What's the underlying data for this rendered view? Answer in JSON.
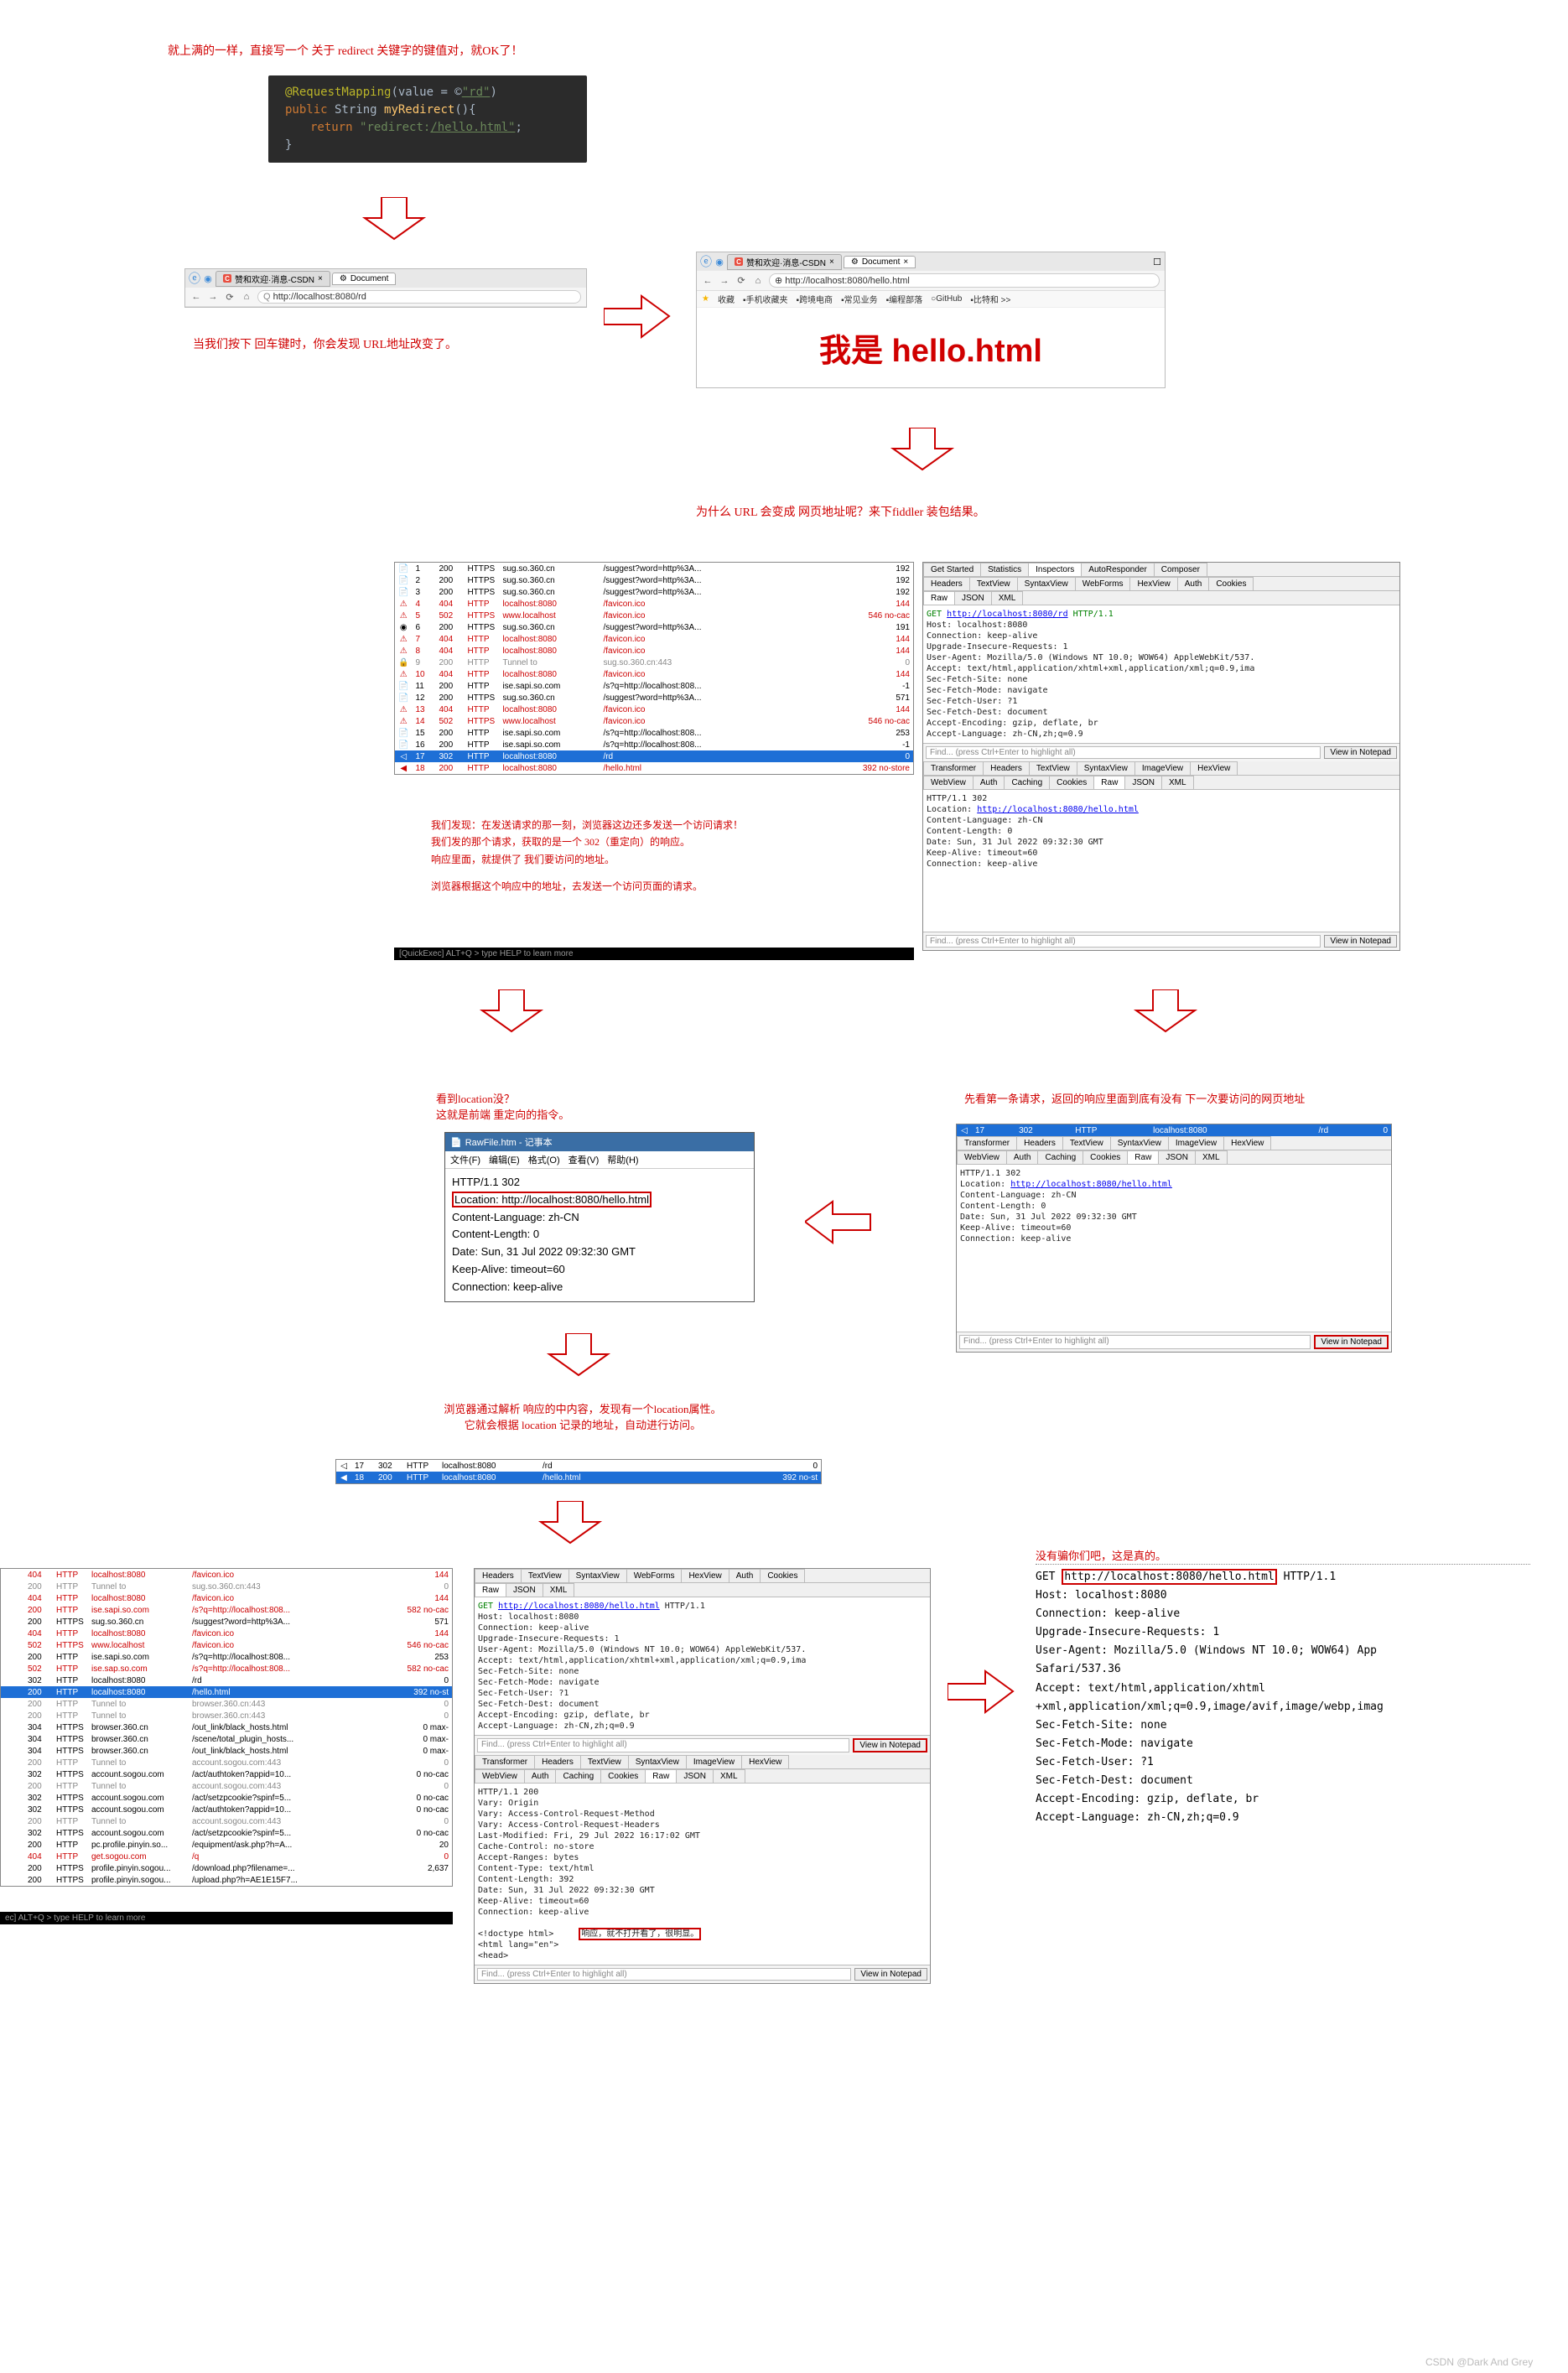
{
  "top_note": "就上满的一样，直接写一个 关于 redirect 关键字的键值对，就OK了！",
  "code": {
    "l1a": "@RequestMapping",
    "l1b": "(value = ",
    "l1c": "©",
    "l1d": "\"rd\"",
    "l1e": ")",
    "l2a": "public",
    "l2b": " String ",
    "l2c": "myRedirect",
    "l2d": "(){",
    "l3a": "return ",
    "l3b": "\"redirect:",
    "l3c": "/hello.html\"",
    "l3d": ";",
    "l4": "}"
  },
  "browser1": {
    "tab1": "赞和欢迎·消息-CSDN",
    "tab2": "Document",
    "url": "http://localhost:8080/rd",
    "url_prefix": "Q"
  },
  "note_below_browser1": "当我们按下 回车键时，你会发现 URL地址改变了。",
  "browser2": {
    "tab1": "赞和欢迎·消息-CSDN",
    "tab2": "Document",
    "url": "http://localhost:8080/hello.html",
    "bookmarks": [
      "收藏",
      "手机收藏夹",
      "跨境电商",
      "常见业务",
      "编程部落",
      "GitHub",
      "比特和 >>"
    ]
  },
  "huge": "我是 hello.html",
  "note_mid": "为什么 URL 会变成 网页地址呢？来下fiddler 装包结果。",
  "fiddler_main_rows": [
    {
      "ic": "📄",
      "n": "1",
      "st": "200",
      "pr": "HTTPS",
      "host": "sug.so.360.cn",
      "path": "/suggest?word=http%3A...",
      "bl": "192",
      "cls": ""
    },
    {
      "ic": "📄",
      "n": "2",
      "st": "200",
      "pr": "HTTPS",
      "host": "sug.so.360.cn",
      "path": "/suggest?word=http%3A...",
      "bl": "192",
      "cls": ""
    },
    {
      "ic": "📄",
      "n": "3",
      "st": "200",
      "pr": "HTTPS",
      "host": "sug.so.360.cn",
      "path": "/suggest?word=http%3A...",
      "bl": "192",
      "cls": ""
    },
    {
      "ic": "⚠",
      "n": "4",
      "st": "404",
      "pr": "HTTP",
      "host": "localhost:8080",
      "path": "/favicon.ico",
      "bl": "144",
      "cls": "red"
    },
    {
      "ic": "⚠",
      "n": "5",
      "st": "502",
      "pr": "HTTPS",
      "host": "www.localhost",
      "path": "/favicon.ico",
      "bl": "546  no-cac",
      "cls": "red"
    },
    {
      "ic": "◉",
      "n": "6",
      "st": "200",
      "pr": "HTTPS",
      "host": "sug.so.360.cn",
      "path": "/suggest?word=http%3A...",
      "bl": "191",
      "cls": ""
    },
    {
      "ic": "⚠",
      "n": "7",
      "st": "404",
      "pr": "HTTP",
      "host": "localhost:8080",
      "path": "/favicon.ico",
      "bl": "144",
      "cls": "red"
    },
    {
      "ic": "⚠",
      "n": "8",
      "st": "404",
      "pr": "HTTP",
      "host": "localhost:8080",
      "path": "/favicon.ico",
      "bl": "144",
      "cls": "red"
    },
    {
      "ic": "🔒",
      "n": "9",
      "st": "200",
      "pr": "HTTP",
      "host": "Tunnel to",
      "path": "sug.so.360.cn:443",
      "bl": "0",
      "cls": "gray"
    },
    {
      "ic": "⚠",
      "n": "10",
      "st": "404",
      "pr": "HTTP",
      "host": "localhost:8080",
      "path": "/favicon.ico",
      "bl": "144",
      "cls": "red"
    },
    {
      "ic": "📄",
      "n": "11",
      "st": "200",
      "pr": "HTTP",
      "host": "ise.sapi.so.com",
      "path": "/s?q=http://localhost:808...",
      "bl": "-1",
      "cls": ""
    },
    {
      "ic": "📄",
      "n": "12",
      "st": "200",
      "pr": "HTTPS",
      "host": "sug.so.360.cn",
      "path": "/suggest?word=http%3A...",
      "bl": "571",
      "cls": ""
    },
    {
      "ic": "⚠",
      "n": "13",
      "st": "404",
      "pr": "HTTP",
      "host": "localhost:8080",
      "path": "/favicon.ico",
      "bl": "144",
      "cls": "red"
    },
    {
      "ic": "⚠",
      "n": "14",
      "st": "502",
      "pr": "HTTPS",
      "host": "www.localhost",
      "path": "/favicon.ico",
      "bl": "546  no-cac",
      "cls": "red"
    },
    {
      "ic": "📄",
      "n": "15",
      "st": "200",
      "pr": "HTTP",
      "host": "ise.sapi.so.com",
      "path": "/s?q=http://localhost:808...",
      "bl": "253",
      "cls": ""
    },
    {
      "ic": "📄",
      "n": "16",
      "st": "200",
      "pr": "HTTP",
      "host": "ise.sapi.so.com",
      "path": "/s?q=http://localhost:808...",
      "bl": "-1",
      "cls": ""
    },
    {
      "ic": "◁",
      "n": "17",
      "st": "302",
      "pr": "HTTP",
      "host": "localhost:8080",
      "path": "/rd",
      "bl": "0",
      "cls": "sel"
    },
    {
      "ic": "◀",
      "n": "18",
      "st": "200",
      "pr": "HTTP",
      "host": "localhost:8080",
      "path": "/hello.html",
      "bl": "392  no-store",
      "cls": "red"
    }
  ],
  "fiddler_analysis_note": {
    "l1": "我们发现：在发送请求的那一刻，浏览器这边还多发送一个访问请求！",
    "l2": "我们发的那个请求，获取的是一个 302（重定向）的响应。",
    "l3": "响应里面，就提供了 我们要访问的地址。",
    "l4": "浏览器根据这个响应中的地址，去发送一个访问页面的请求。"
  },
  "quickexec": "[QuickExec] ALT+Q > type HELP to learn more",
  "inspector_tabs_top": [
    "Get Started",
    "Statistics",
    "Inspectors",
    "AutoResponder",
    "Composer"
  ],
  "inspector_tabs_req": [
    "Headers",
    "TextView",
    "SyntaxView",
    "WebForms",
    "HexView",
    "Auth",
    "Cookies"
  ],
  "inspector_tabs_raw": [
    "Raw",
    "JSON",
    "XML"
  ],
  "req_raw": "GET http://localhost:8080/rd HTTP/1.1\nHost: localhost:8080\nConnection: keep-alive\nUpgrade-Insecure-Requests: 1\nUser-Agent: Mozilla/5.0 (Windows NT 10.0; WOW64) AppleWebKit/537.\nAccept: text/html,application/xhtml+xml,application/xml;q=0.9,ima\nSec-Fetch-Site: none\nSec-Fetch-Mode: navigate\nSec-Fetch-User: ?1\nSec-Fetch-Dest: document\nAccept-Encoding: gzip, deflate, br\nAccept-Language: zh-CN,zh;q=0.9",
  "find_placeholder": "Find... (press Ctrl+Enter to highlight all)",
  "notepad_btn": "View in Notepad",
  "inspector_tabs_res": [
    "Transformer",
    "Headers",
    "TextView",
    "SyntaxView",
    "ImageView",
    "HexView"
  ],
  "inspector_tabs_res2": [
    "WebView",
    "Auth",
    "Caching",
    "Cookies",
    "Raw",
    "JSON",
    "XML"
  ],
  "res_raw": "HTTP/1.1 302\nLocation: http://localhost:8080/hello.html\nContent-Language: zh-CN\nContent-Length: 0\nDate: Sun, 31 Jul 2022 09:32:30 GMT\nKeep-Alive: timeout=60\nConnection: keep-alive",
  "note_loc1": "看到location没？",
  "note_loc2": "这就是前端 重定向的指令。",
  "note_first_req": "先看第一条请求，返回的响应里面到底有没有 下一次要访问的网页地址",
  "notepad": {
    "title": "RawFile.htm - 记事本",
    "menu": [
      "文件(F)",
      "编辑(E)",
      "格式(O)",
      "查看(V)",
      "帮助(H)"
    ],
    "lines": [
      "HTTP/1.1 302",
      "Location: http://localhost:8080/hello.html",
      "Content-Language: zh-CN",
      "Content-Length: 0",
      "Date: Sun, 31 Jul 2022 09:32:30 GMT",
      "Keep-Alive: timeout=60",
      "Connection: keep-alive"
    ]
  },
  "note_parse1": "浏览器通过解析 响应的中内容，发现有一个location属性。",
  "note_parse2": "它就会根据 location 记录的地址，自动进行访问。",
  "fiddler_mini_rows": [
    {
      "ic": "◁",
      "n": "17",
      "st": "302",
      "pr": "HTTP",
      "host": "localhost:8080",
      "path": "/rd",
      "bl": "0",
      "cls": ""
    },
    {
      "ic": "◀",
      "n": "18",
      "st": "200",
      "pr": "HTTP",
      "host": "localhost:8080",
      "path": "/hello.html",
      "bl": "392  no-st",
      "cls": "sel"
    }
  ],
  "fiddler_bottom_rows": [
    {
      "n": "",
      "st": "404",
      "pr": "HTTP",
      "host": "localhost:8080",
      "path": "/favicon.ico",
      "bl": "144",
      "cls": "red"
    },
    {
      "n": "",
      "st": "200",
      "pr": "HTTP",
      "host": "Tunnel to",
      "path": "sug.so.360.cn:443",
      "bl": "0",
      "cls": "gray"
    },
    {
      "n": "",
      "st": "404",
      "pr": "HTTP",
      "host": "localhost:8080",
      "path": "/favicon.ico",
      "bl": "144",
      "cls": "red"
    },
    {
      "n": "",
      "st": "200",
      "pr": "HTTP",
      "host": "ise.sapi.so.com",
      "path": "/s?q=http://localhost:808...",
      "bl": "582  no-cac",
      "cls": "red"
    },
    {
      "n": "",
      "st": "200",
      "pr": "HTTPS",
      "host": "sug.so.360.cn",
      "path": "/suggest?word=http%3A...",
      "bl": "571",
      "cls": ""
    },
    {
      "n": "",
      "st": "404",
      "pr": "HTTP",
      "host": "localhost:8080",
      "path": "/favicon.ico",
      "bl": "144",
      "cls": "red"
    },
    {
      "n": "",
      "st": "502",
      "pr": "HTTPS",
      "host": "www.localhost",
      "path": "/favicon.ico",
      "bl": "546  no-cac",
      "cls": "red"
    },
    {
      "n": "",
      "st": "200",
      "pr": "HTTP",
      "host": "ise.sapi.so.com",
      "path": "/s?q=http://localhost:808...",
      "bl": "253",
      "cls": ""
    },
    {
      "n": "",
      "st": "502",
      "pr": "HTTP",
      "host": "ise.sap.so.com",
      "path": "/s?q=http://localhost:808...",
      "bl": "582  no-cac",
      "cls": "red"
    },
    {
      "n": "",
      "st": "302",
      "pr": "HTTP",
      "host": "localhost:8080",
      "path": "/rd",
      "bl": "0",
      "cls": ""
    },
    {
      "n": "",
      "st": "200",
      "pr": "HTTP",
      "host": "localhost:8080",
      "path": "/hello.html",
      "bl": "392  no-st",
      "cls": "sel"
    },
    {
      "n": "",
      "st": "200",
      "pr": "HTTP",
      "host": "Tunnel to",
      "path": "browser.360.cn:443",
      "bl": "0",
      "cls": "gray"
    },
    {
      "n": "",
      "st": "200",
      "pr": "HTTP",
      "host": "Tunnel to",
      "path": "browser.360.cn:443",
      "bl": "0",
      "cls": "gray"
    },
    {
      "n": "",
      "st": "304",
      "pr": "HTTPS",
      "host": "browser.360.cn",
      "path": "/out_link/black_hosts.html",
      "bl": "0  max-",
      "cls": ""
    },
    {
      "n": "",
      "st": "304",
      "pr": "HTTPS",
      "host": "browser.360.cn",
      "path": "/scene/total_plugin_hosts...",
      "bl": "0  max-",
      "cls": ""
    },
    {
      "n": "",
      "st": "304",
      "pr": "HTTPS",
      "host": "browser.360.cn",
      "path": "/out_link/black_hosts.html",
      "bl": "0  max-",
      "cls": ""
    },
    {
      "n": "",
      "st": "200",
      "pr": "HTTP",
      "host": "Tunnel to",
      "path": "account.sogou.com:443",
      "bl": "0",
      "cls": "gray"
    },
    {
      "n": "",
      "st": "302",
      "pr": "HTTPS",
      "host": "account.sogou.com",
      "path": "/act/authtoken?appid=10...",
      "bl": "0  no-cac",
      "cls": ""
    },
    {
      "n": "",
      "st": "200",
      "pr": "HTTP",
      "host": "Tunnel to",
      "path": "account.sogou.com:443",
      "bl": "0",
      "cls": "gray"
    },
    {
      "n": "",
      "st": "302",
      "pr": "HTTPS",
      "host": "account.sogou.com",
      "path": "/act/setzpcookie?spinf=5...",
      "bl": "0  no-cac",
      "cls": ""
    },
    {
      "n": "",
      "st": "302",
      "pr": "HTTPS",
      "host": "account.sogou.com",
      "path": "/act/authtoken?appid=10...",
      "bl": "0  no-cac",
      "cls": ""
    },
    {
      "n": "",
      "st": "200",
      "pr": "HTTP",
      "host": "Tunnel to",
      "path": "account.sogou.com:443",
      "bl": "0",
      "cls": "gray"
    },
    {
      "n": "",
      "st": "302",
      "pr": "HTTPS",
      "host": "account.sogou.com",
      "path": "/act/setzpcookie?spinf=5...",
      "bl": "0  no-cac",
      "cls": ""
    },
    {
      "n": "",
      "st": "200",
      "pr": "HTTP",
      "host": "pc.profile.pinyin.so...",
      "path": "/equipment/ask.php?h=A...",
      "bl": "20",
      "cls": ""
    },
    {
      "n": "",
      "st": "404",
      "pr": "HTTP",
      "host": "get.sogou.com",
      "path": "/q",
      "bl": "0",
      "cls": "red"
    },
    {
      "n": "",
      "st": "200",
      "pr": "HTTPS",
      "host": "profile.pinyin.sogou...",
      "path": "/download.php?filename=...",
      "bl": "2,637",
      "cls": ""
    },
    {
      "n": "",
      "st": "200",
      "pr": "HTTPS",
      "host": "profile.pinyin.sogou...",
      "path": "/upload.php?h=AE1E15F7...",
      "bl": "",
      "cls": ""
    }
  ],
  "quickexec2": "ec] ALT+Q > type HELP to learn more",
  "req_hello_raw": "GET http://localhost:8080/hello.html HTTP/1.1\nHost: localhost:8080\nConnection: keep-alive\nUpgrade-Insecure-Requests: 1\nUser-Agent: Mozilla/5.0 (Windows NT 10.0; WOW64) AppleWebKit/537.\nAccept: text/html,application/xhtml+xml,application/xml;q=0.9,ima\nSec-Fetch-Site: none\nSec-Fetch-Mode: navigate\nSec-Fetch-User: ?1\nSec-Fetch-Dest: document\nAccept-Encoding: gzip, deflate, br\nAccept-Language: zh-CN,zh;q=0.9",
  "res_hello_raw": "HTTP/1.1 200\nVary: Origin\nVary: Access-Control-Request-Method\nVary: Access-Control-Request-Headers\nLast-Modified: Fri, 29 Jul 2022 16:17:02 GMT\nCache-Control: no-store\nAccept-Ranges: bytes\nContent-Type: text/html\nContent-Length: 392\nDate: Sun, 31 Jul 2022 09:32:30 GMT\nKeep-Alive: timeout=60\nConnection: keep-alive\n\n<!doctype html>\n<html lang=\"en\">\n<head>",
  "res_hello_note": "响应，就不打开看了，很明显。",
  "note_truth": "没有骗你们吧，这是真的。",
  "final_text": {
    "l1a": "GET ",
    "l1b": "http://localhost:8080/hello.html",
    "l1c": " HTTP/1.1",
    "l2": "Host: localhost:8080",
    "l3": "Connection: keep-alive",
    "l4": "Upgrade-Insecure-Requests: 1",
    "l5": "User-Agent: Mozilla/5.0 (Windows NT 10.0; WOW64) App",
    "l6": "Safari/537.36",
    "l7": "Accept: text/html,application/xhtml",
    "l8": "+xml,application/xml;q=0.9,image/avif,image/webp,imag",
    "l9": "Sec-Fetch-Site: none",
    "l10": "Sec-Fetch-Mode: navigate",
    "l11": "Sec-Fetch-User: ?1",
    "l12": "Sec-Fetch-Dest: document",
    "l13": "Accept-Encoding: gzip, deflate, br",
    "l14": "Accept-Language: zh-CN,zh;q=0.9"
  },
  "watermark": "CSDN @Dark And Grey"
}
